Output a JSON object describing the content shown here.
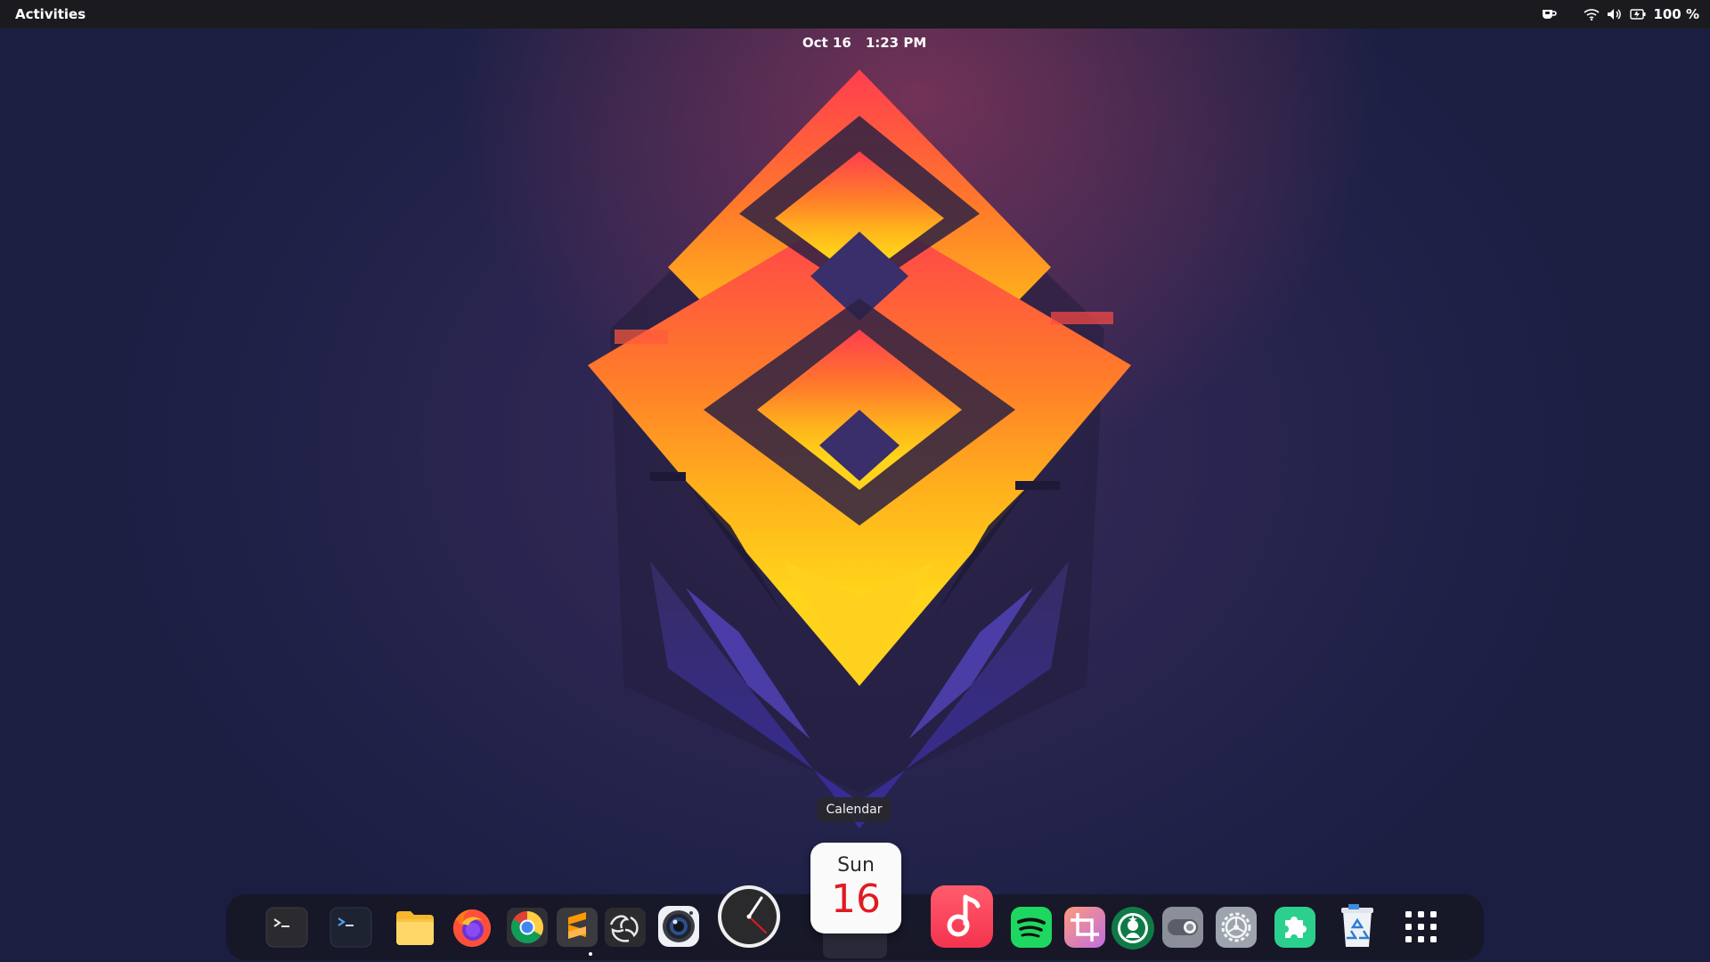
{
  "topbar": {
    "activities_label": "Activities",
    "date": "Oct 16",
    "time": "1:23 PM",
    "battery_percent": "100 %",
    "icons": [
      "coffee-cup-icon",
      "wifi-icon",
      "volume-icon",
      "battery-icon"
    ]
  },
  "tooltip": {
    "label": "Calendar"
  },
  "calendar_icon": {
    "day": "Sun",
    "date": "16"
  },
  "dock": {
    "items": [
      {
        "name": "terminal",
        "icon": "terminal-icon"
      },
      {
        "name": "terminal-alt",
        "icon": "terminal-alt-icon"
      },
      {
        "name": "files",
        "icon": "folder-icon"
      },
      {
        "name": "firefox",
        "icon": "firefox-icon"
      },
      {
        "name": "chrome",
        "icon": "chrome-icon"
      },
      {
        "name": "sublime-text",
        "icon": "sublime-text-icon"
      },
      {
        "name": "obs-studio",
        "icon": "obs-icon"
      },
      {
        "name": "camera",
        "icon": "camera-icon"
      },
      {
        "name": "clock",
        "icon": "clock-icon"
      },
      {
        "name": "calendar",
        "icon": "calendar-icon"
      },
      {
        "name": "music",
        "icon": "music-note-icon"
      },
      {
        "name": "spotify",
        "icon": "spotify-icon"
      },
      {
        "name": "screenshot-crop",
        "icon": "crop-icon"
      },
      {
        "name": "starbucks",
        "icon": "starbucks-icon"
      },
      {
        "name": "tweaks",
        "icon": "toggle-icon"
      },
      {
        "name": "settings",
        "icon": "gear-icon"
      },
      {
        "name": "extensions",
        "icon": "puzzle-icon"
      },
      {
        "name": "trash",
        "icon": "recycle-bin-icon"
      },
      {
        "name": "show-applications",
        "icon": "app-grid-icon"
      }
    ],
    "running_apps": [
      "obs-studio"
    ]
  },
  "colors": {
    "topbar_bg": "#1b1a1f",
    "calendar_red": "#e01b24",
    "music_pink": "#fa3d5a",
    "spotify_green": "#1ed760",
    "extensions_green": "#2bcf8e"
  }
}
